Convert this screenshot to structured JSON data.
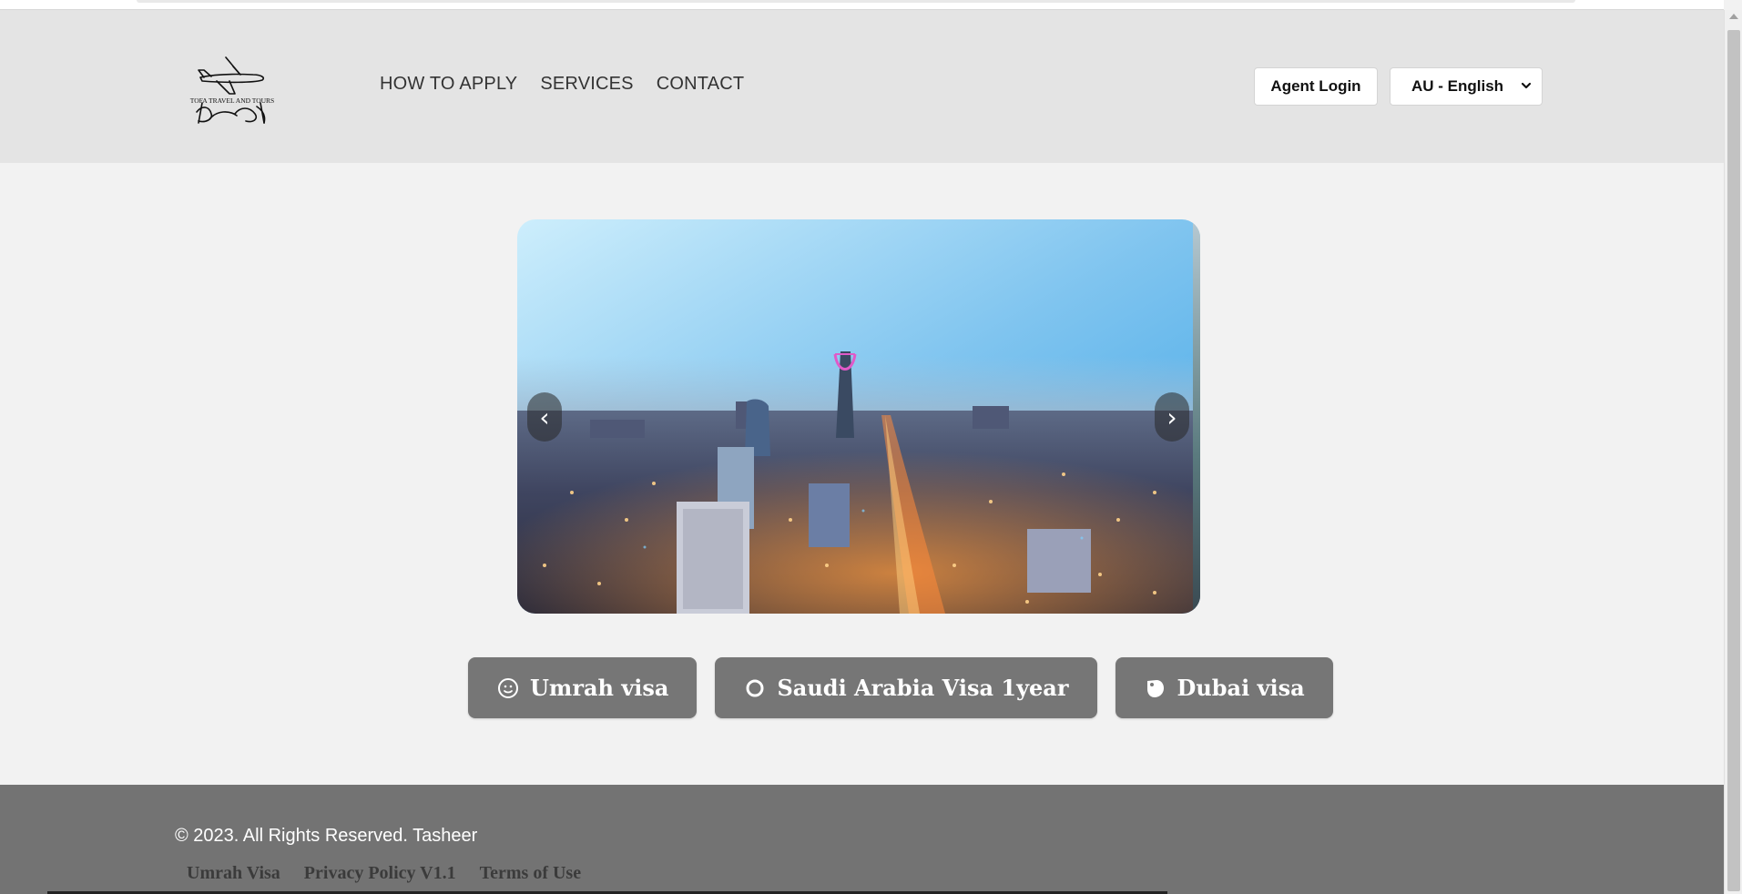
{
  "header": {
    "logo_text": "TOFA TRAVEL AND TOURS",
    "nav": [
      {
        "label": "HOW TO APPLY"
      },
      {
        "label": "SERVICES"
      },
      {
        "label": "CONTACT"
      }
    ],
    "agent_login_label": "Agent Login",
    "language_selected": "AU - English"
  },
  "slider": {
    "prev_symbol": "‹",
    "next_symbol": "›"
  },
  "visa_buttons": [
    {
      "label": "Umrah visa",
      "icon": "smiley-icon"
    },
    {
      "label": "Saudi Arabia Visa 1year",
      "icon": "circle-icon"
    },
    {
      "label": "Dubai visa",
      "icon": "tag-icon"
    }
  ],
  "footer": {
    "copyright": "© 2023. All Rights Reserved. Tasheer",
    "links": [
      {
        "label": "Umrah Visa"
      },
      {
        "label": "Privacy Policy V1.1"
      },
      {
        "label": "Terms of Use"
      }
    ]
  },
  "colors": {
    "header_bg": "#e4e4e4",
    "page_bg": "#f2f2f2",
    "button_bg": "#767676",
    "footer_bg": "#737373"
  }
}
